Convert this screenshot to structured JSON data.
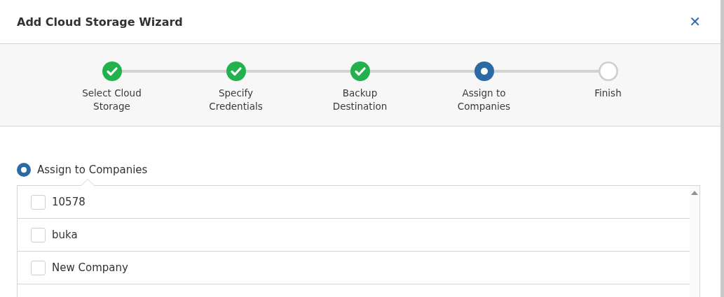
{
  "dialog": {
    "title": "Add Cloud Storage Wizard",
    "close": "✕"
  },
  "steps": [
    {
      "label": "Select Cloud Storage",
      "kind": "done"
    },
    {
      "label": "Specify Credentials",
      "kind": "done"
    },
    {
      "label": "Backup Destination",
      "kind": "done"
    },
    {
      "label": "Assign to Companies",
      "kind": "current"
    },
    {
      "label": "Finish",
      "kind": "pending"
    }
  ],
  "option": {
    "label": "Assign to Companies",
    "selected": true
  },
  "companies": [
    {
      "name": "10578",
      "checked": false
    },
    {
      "name": "buka",
      "checked": false
    },
    {
      "name": "New Company",
      "checked": false
    }
  ]
}
